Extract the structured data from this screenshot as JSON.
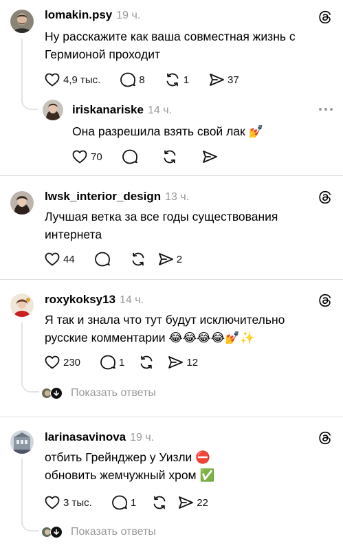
{
  "posts": [
    {
      "username": "lomakin.psy",
      "time": "19 ч.",
      "text_lines": [
        "Ну расскажите как ваша совместная жизнь с",
        "Гермионой проходит"
      ],
      "likes": "4,9 тыс.",
      "replies": "8",
      "reposts": "1",
      "shares": "37",
      "reply": {
        "username": "iriskanariske",
        "time": "14 ч.",
        "text": "Она разрешила взять свой лак 💅",
        "likes": "70"
      }
    },
    {
      "username": "lwsk_interior_design",
      "time": "13 ч.",
      "text_lines": [
        "Лучшая ветка за все годы существования",
        "интернета"
      ],
      "likes": "44",
      "shares": "2"
    },
    {
      "username": "roxykoksy13",
      "time": "14 ч.",
      "text_lines": [
        "Я так и знала что тут будут исключительно",
        "русские комментарии 😂😂😂😂💅✨"
      ],
      "likes": "230",
      "replies": "1",
      "shares": "12",
      "show_replies": "Показать ответы"
    },
    {
      "username": "larinasavinova",
      "time": "19 ч.",
      "text_lines": [
        "отбить Грейнджер у Уизли ⛔",
        "обновить жемчужный хром ✅"
      ],
      "likes": "3 тыс.",
      "replies": "1",
      "shares": "22",
      "show_replies": "Показать ответы"
    }
  ],
  "icons": {
    "like": "heart-icon",
    "reply": "comment-icon",
    "repost": "repost-icon",
    "share": "share-icon",
    "threads": "threads-logo-icon",
    "more": "more-icon"
  },
  "colors": {
    "text": "#000000",
    "muted": "#999999",
    "divider": "#dedede"
  }
}
